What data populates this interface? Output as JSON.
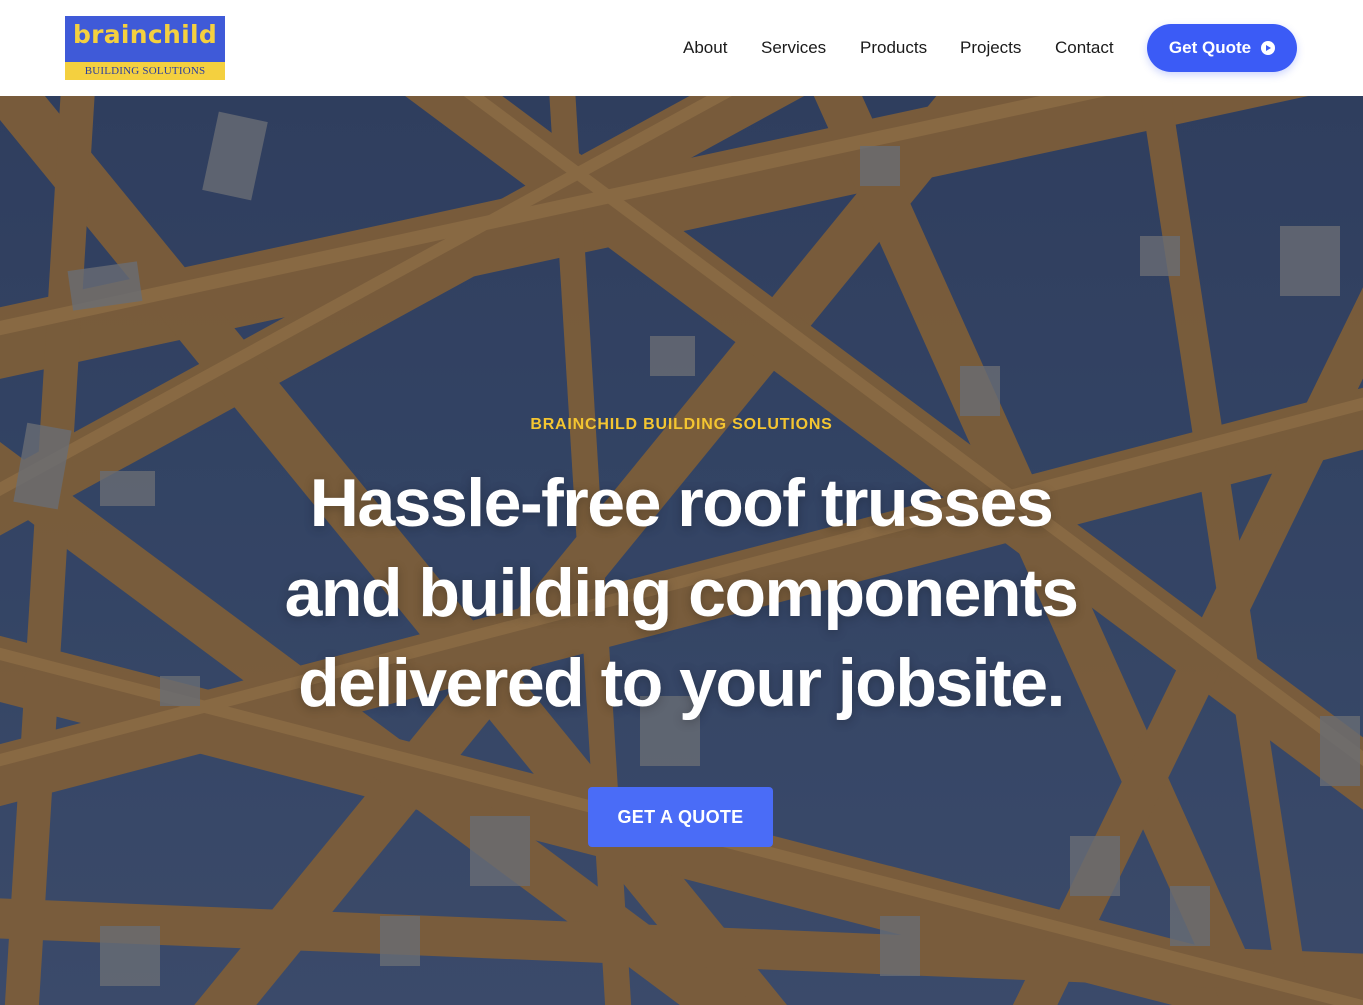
{
  "header": {
    "logo": {
      "word": "brainchild",
      "tagline": "BUILDING SOLUTIONS"
    },
    "nav": [
      {
        "label": "About"
      },
      {
        "label": "Services"
      },
      {
        "label": "Products"
      },
      {
        "label": "Projects"
      },
      {
        "label": "Contact"
      }
    ],
    "cta": {
      "label": "Get Quote",
      "icon": "arrow-circle-right-icon"
    }
  },
  "hero": {
    "background": "roof-truss-photo",
    "kicker": "BRAINCHILD BUILDING SOLUTIONS",
    "title_lines": [
      "Hassle-free roof trusses",
      "and building components",
      "delivered to your jobsite."
    ],
    "cta": {
      "label": "GET A QUOTE"
    }
  },
  "colors": {
    "brand_blue": "#3b5bf6",
    "logo_blue": "#3f5ad8",
    "brand_yellow": "#f4d03f",
    "kicker_yellow": "#f4c531"
  }
}
